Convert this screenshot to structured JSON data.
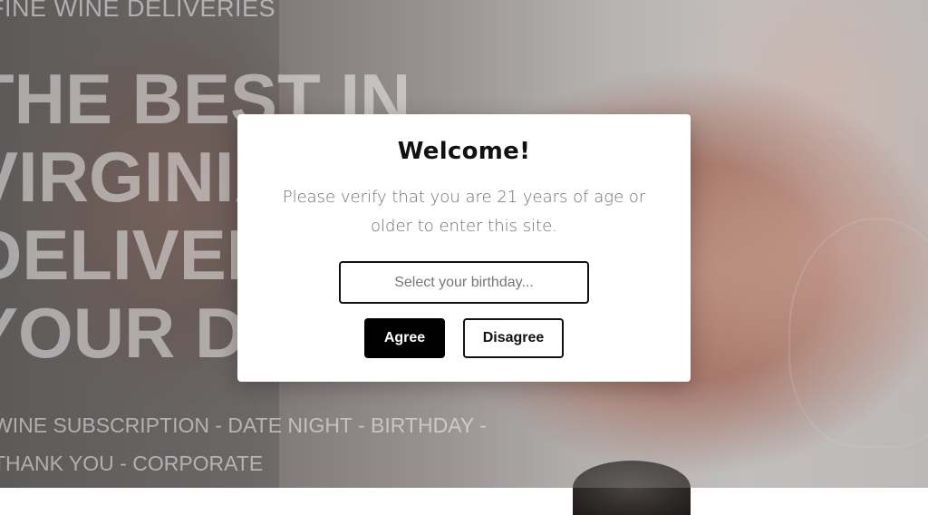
{
  "background": {
    "top_tag": "FINE WINE DELIVERIES",
    "headline_lines": [
      "THE BEST IN",
      "VIRGINIA",
      "DELIVERED",
      "YOUR DOOR"
    ],
    "occasions_lines": [
      "WINE SUBSCRIPTION - DATE NIGHT - BIRTHDAY -",
      "THANK YOU - CORPORATE"
    ]
  },
  "modal": {
    "title": "Welcome!",
    "message": "Please verify that you are 21 years of age or older to enter this site.",
    "birthday_input": {
      "placeholder": "Select your birthday...",
      "value": ""
    },
    "agree_label": "Agree",
    "disagree_label": "Disagree"
  },
  "colors": {
    "modal_bg": "#ffffff",
    "agree_bg": "#000000",
    "text_muted": "#6f6f6f"
  }
}
